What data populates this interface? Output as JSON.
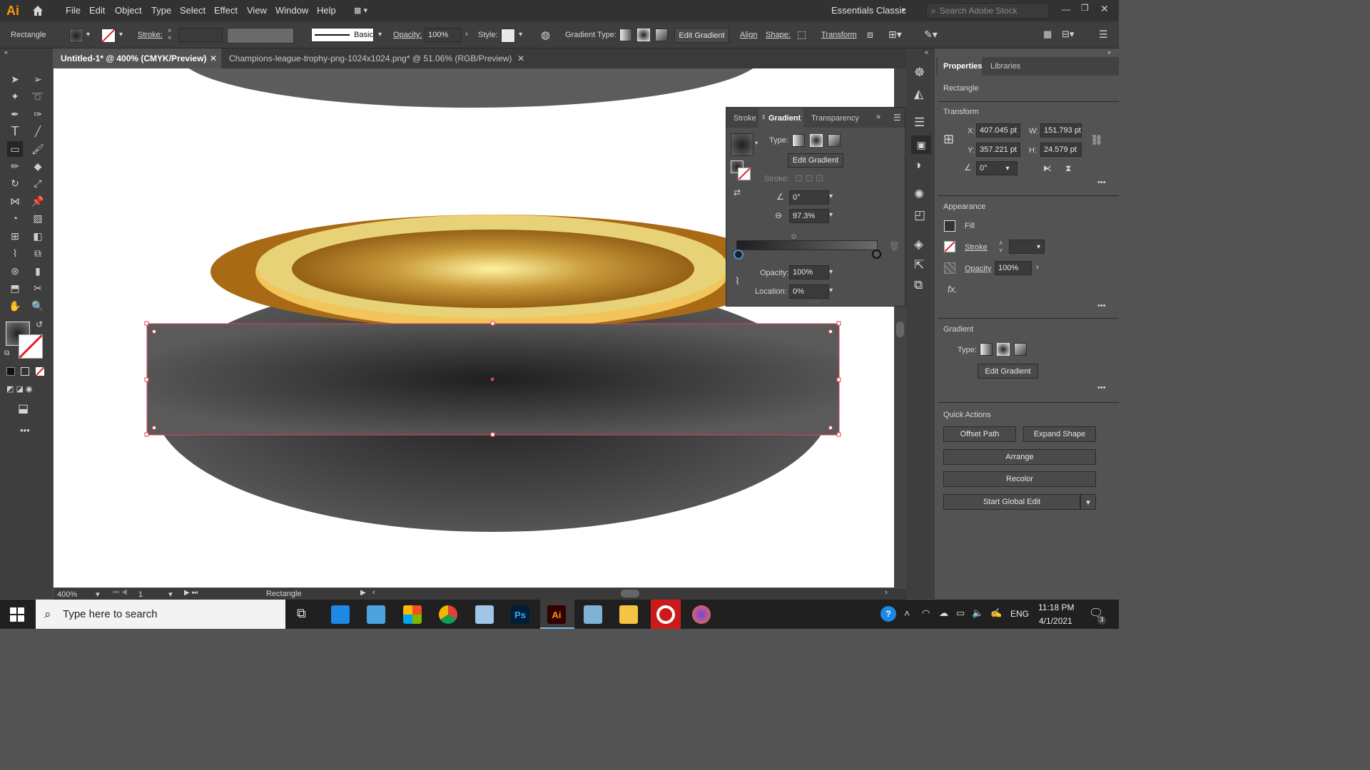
{
  "app": {
    "logo": "Ai",
    "workspace": "Essentials Classic",
    "search_placeholder": "Search Adobe Stock"
  },
  "menu": [
    "File",
    "Edit",
    "Object",
    "Type",
    "Select",
    "Effect",
    "View",
    "Window",
    "Help"
  ],
  "control": {
    "object_type": "Rectangle",
    "stroke_label": "Stroke:",
    "brush": "Basic",
    "opacity_label": "Opacity:",
    "opacity_value": "100%",
    "style_label": "Style:",
    "gradient_type_label": "Gradient Type:",
    "edit_gradient": "Edit Gradient",
    "align": "Align",
    "shape": "Shape:",
    "transform": "Transform"
  },
  "tabs": [
    {
      "label": "Untitled-1* @ 400% (CMYK/Preview)"
    },
    {
      "label": "Champions-league-trophy-png-1024x1024.png* @ 51.06% (RGB/Preview)"
    }
  ],
  "status": {
    "zoom": "400%",
    "artboard": "1",
    "tool_name": "Rectangle"
  },
  "gradient_panel": {
    "tabs": [
      "Stroke",
      "Gradient",
      "Transparency"
    ],
    "type_label": "Type:",
    "edit_gradient": "Edit Gradient",
    "stroke_label": "Stroke:",
    "angle": "0°",
    "aspect": "97.3%",
    "opacity_label": "Opacity:",
    "opacity_value": "100%",
    "location_label": "Location:",
    "location_value": "0%"
  },
  "properties": {
    "tabs": [
      "Properties",
      "Libraries"
    ],
    "object": "Rectangle",
    "transform_title": "Transform",
    "x_label": "X:",
    "x": "407.045 pt",
    "w_label": "W:",
    "w": "151.793 pt",
    "y_label": "Y:",
    "y": "357.221 pt",
    "h_label": "H:",
    "h": "24.579 pt",
    "rotate": "0°",
    "appearance_title": "Appearance",
    "fill": "Fill",
    "stroke": "Stroke",
    "opacity": "Opacity",
    "opacity_value": "100%",
    "fx": "fx.",
    "gradient_title": "Gradient",
    "type_label": "Type:",
    "edit_gradient": "Edit Gradient",
    "quick_actions_title": "Quick Actions",
    "offset_path": "Offset Path",
    "expand_shape": "Expand Shape",
    "arrange": "Arrange",
    "recolor": "Recolor",
    "start_global_edit": "Start Global Edit"
  },
  "taskbar": {
    "search": "Type here to search",
    "lang": "ENG",
    "time": "11:18 PM",
    "date": "4/1/2021",
    "notif_count": "3"
  },
  "colors": {
    "accent": "#ff9a00",
    "selection": "#e0444f",
    "ui_dark": "#323232",
    "ui_mid": "#535353"
  }
}
